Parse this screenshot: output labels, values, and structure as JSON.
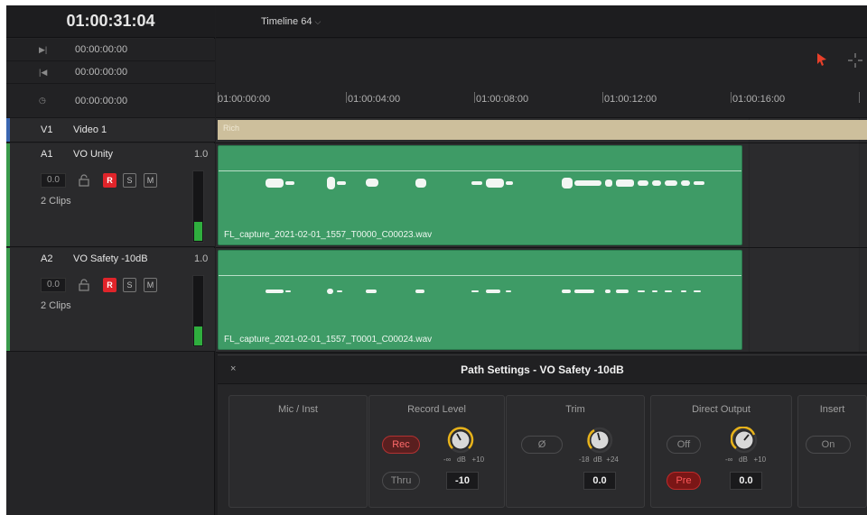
{
  "timecode": "01:00:31:04",
  "timeline_name": "Timeline 64",
  "timecode_rows": [
    {
      "icon": "next-frame-icon",
      "glyph": "▶|",
      "value": "00:00:00:00"
    },
    {
      "icon": "prev-frame-icon",
      "glyph": "|◀",
      "value": "00:00:00:00"
    },
    {
      "icon": "clock-icon",
      "glyph": "◷",
      "value": "00:00:00:00"
    }
  ],
  "ruler": [
    "01:00:00:00",
    "01:00:04:00",
    "01:00:08:00",
    "01:00:12:00",
    "01:00:16:00"
  ],
  "tracks": {
    "v1": {
      "id": "V1",
      "name": "Video 1",
      "clip": "Rich"
    },
    "a1": {
      "id": "A1",
      "name": "VO Unity",
      "level": "1.0",
      "volume": "0.0",
      "r": "R",
      "s": "S",
      "m": "M",
      "clips": "2 Clips",
      "meter": 0.28,
      "file": "FL_capture_2021-02-01_1557_T0000_C00023.wav"
    },
    "a2": {
      "id": "A2",
      "name": "VO Safety -10dB",
      "level": "1.0",
      "volume": "0.0",
      "r": "R",
      "s": "S",
      "m": "M",
      "clips": "2 Clips",
      "meter": 0.28,
      "file": "FL_capture_2021-02-01_1557_T0001_C00024.wav"
    }
  },
  "path_settings": {
    "title": "Path Settings - VO Safety -10dB",
    "close": "×",
    "mic_inst": {
      "label": "Mic / Inst"
    },
    "record_level": {
      "label": "Record Level",
      "rec": "Rec",
      "thru": "Thru",
      "scale_min": "-∞",
      "scale_unit": "dB",
      "scale_max": "+10",
      "value": "-10"
    },
    "trim": {
      "label": "Trim",
      "phase": "Ø",
      "scale_min": "-18",
      "scale_unit": "dB",
      "scale_max": "+24",
      "value": "0.0"
    },
    "direct_output": {
      "label": "Direct Output",
      "off": "Off",
      "pre": "Pre",
      "scale_min": "-∞",
      "scale_unit": "dB",
      "scale_max": "+10",
      "value": "0.0"
    },
    "insert": {
      "label": "Insert",
      "on": "On"
    }
  },
  "colors": {
    "accent_red": "#e0242a",
    "clip_green": "#3e9b66",
    "knob_yellow": "#e7b21a",
    "video_clip": "#cdbf9c"
  }
}
